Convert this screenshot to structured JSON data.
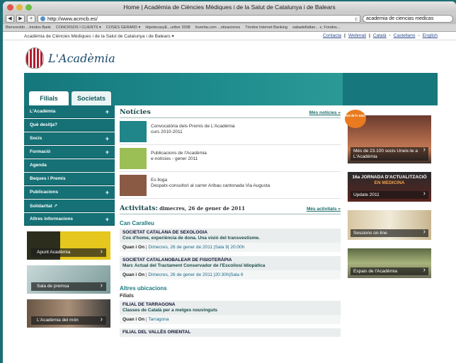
{
  "window": {
    "title": "Home | Acadèmia de Ciències Mèdiques i de la Salut de Catalunya i de Balears"
  },
  "toolbar": {
    "url": "http://www.acmcb.es/",
    "search": "academia de ciencias medicas",
    "back": "◀",
    "forward": "▶",
    "add": "+",
    "reload": "c"
  },
  "bookmarks": [
    "Bienvenido ...triodos Bank",
    "CONCRSOS I CLIENTS ▾",
    "COSES GERARD ▾",
    "HipotecasyE...uribor 2008",
    "Invertia.com ...otizaciones",
    "Triodos Internet Banking",
    "sabadellatlan... s, Fondos..."
  ],
  "topstrip": {
    "site": "Acadèmia de Ciències Mèdiques i de la Salut de Catalunya i de Balears ▾",
    "links": [
      "Contacta",
      "|",
      "Webmail",
      "|",
      "Català",
      "·",
      "Castellano",
      "·",
      "English"
    ]
  },
  "brand": {
    "name": "L'Acadèmia"
  },
  "tabs": [
    "Filials",
    "Societats"
  ],
  "menu": [
    {
      "label": "L'Acadèmia",
      "plus": "+"
    },
    {
      "label": "Què desitja?",
      "plus": ""
    },
    {
      "label": "Socis",
      "plus": "+"
    },
    {
      "label": "Formació",
      "plus": "+"
    },
    {
      "label": "Agenda",
      "plus": ""
    },
    {
      "label": "Beques i Premis",
      "plus": ""
    },
    {
      "label": "Publicacions",
      "plus": "+"
    },
    {
      "label": "Solidaritat ↗",
      "plus": ""
    },
    {
      "label": "Altres informacions",
      "plus": "+"
    }
  ],
  "promos": [
    "Apunt Acadèmia",
    "Sala de premsa",
    "L'Acadèmia del món"
  ],
  "noticies": {
    "title": "Notícies",
    "more": "Més notícies »",
    "items": [
      {
        "line1": "Convocatòria dels Premis de L'Acadèmia",
        "line2": "curs 2010-2011"
      },
      {
        "line1": "Publicacions de l'Acadèmia",
        "line2": "e-notícies - gener 2011"
      },
      {
        "line1": "Es lloga",
        "line2": "Despatx-consultori al carrer Aribau cantonada Via Augusta"
      }
    ]
  },
  "activitats": {
    "title": "Activitats:",
    "date": "dimecres, 26 de gener de 2011",
    "more": "Més activitats »",
    "sub1": "Can Caralleu",
    "events": [
      {
        "org": "SOCIETAT CATALANA DE SEXOLOGIA",
        "title": "Cos d'home, experiència de dona. Una visió del transvestisme.",
        "meta_label": "Quan i On",
        "meta": "Dimecres, 26 de gener de 2011 |Sala 9| 20:00h"
      },
      {
        "org": "SOCIETAT CATALANOBALEAR DE FISIOTERÀPIA",
        "title": "Marc Actual del Tractament Conservador de l'Escoliosi Idiopàtica",
        "meta_label": "Quan i On",
        "meta": "Dimecres, 26 de gener de 2011 |20:30h|Sala 6"
      }
    ],
    "sub2": "Altres ubicacions",
    "filials_label": "Filials",
    "filial_events": [
      {
        "org": "FILIAL DE TARRAGONA",
        "title": "Classes de Català per a metges nouvinguts",
        "meta_label": "Quan i On",
        "meta": "Tarragona"
      },
      {
        "org": "FILIAL DEL VALLÈS ORIENTAL",
        "title": "",
        "meta_label": "",
        "meta": ""
      }
    ]
  },
  "right": {
    "sticker": "fes-te'n soci",
    "socis": "Més de 23.100 socis Uneix-te a L'Acadèmia",
    "jornada_line1": "16a JORNADA D'ACTUALITZACIÓ",
    "jornada_line2": "EN MEDICINA",
    "jornada_caption": "Update 2011",
    "sessions": "Sessions on-line",
    "espais": "Espais de l'Acadèmia"
  }
}
